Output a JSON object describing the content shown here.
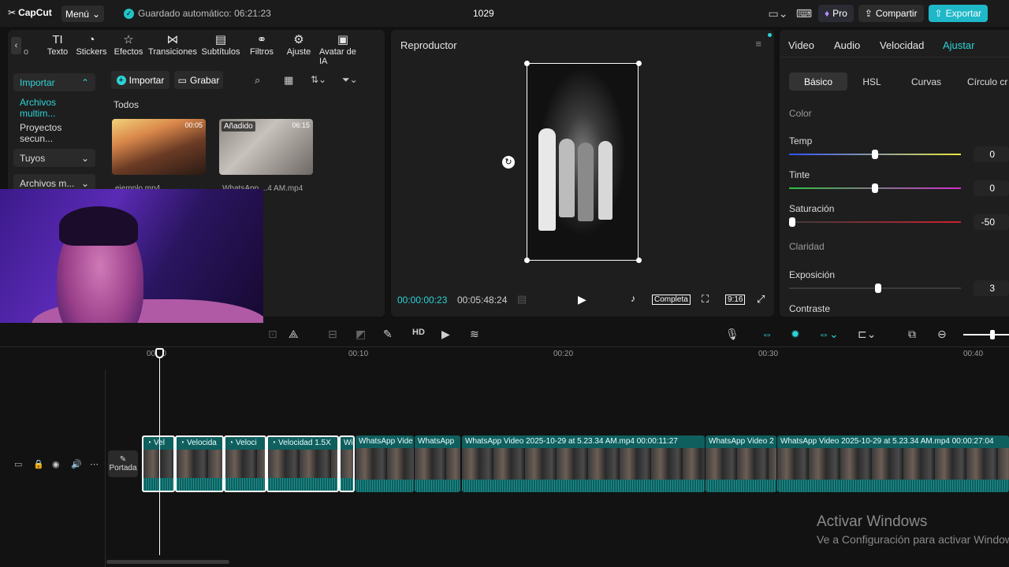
{
  "topbar": {
    "logo": "CapCut",
    "menu_label": "Menú",
    "autosave": "Guardado automático: 06:21:23",
    "project_title": "1029",
    "pro_label": "Pro",
    "share_label": "Compartir",
    "export_label": "Exportar"
  },
  "toolbar_tabs": [
    {
      "label": "Texto",
      "icon": "text-icon"
    },
    {
      "label": "Stickers",
      "icon": "sticker-icon"
    },
    {
      "label": "Efectos",
      "icon": "effects-icon"
    },
    {
      "label": "Transiciones",
      "icon": "transition-icon"
    },
    {
      "label": "Subtítulos",
      "icon": "subtitle-icon"
    },
    {
      "label": "Filtros",
      "icon": "filter-icon"
    },
    {
      "label": "Ajuste",
      "icon": "adjust-icon"
    },
    {
      "label": "Avatar de IA",
      "icon": "avatar-icon"
    }
  ],
  "sidebar": {
    "importar": "Importar",
    "archivos": "Archivos multim...",
    "proyectos": "Proyectos secun...",
    "tuyos": "Tuyos",
    "archivos2": "Archivos m..."
  },
  "media": {
    "import_btn": "Importar",
    "record_btn": "Grabar",
    "filter_all": "Todos",
    "items": [
      {
        "name": "ejemplo.mp4",
        "duration": "00:05"
      },
      {
        "name": "WhatsApp ...4 AM.mp4",
        "duration": "06:15",
        "badge": "Añadido"
      }
    ]
  },
  "player": {
    "title": "Reproductor",
    "current_time": "00:00:00:23",
    "total_time": "00:05:48:24",
    "quality": "Completa",
    "ratio": "9:16"
  },
  "adjust_panel": {
    "tabs": [
      "Video",
      "Audio",
      "Velocidad",
      "Ajustar"
    ],
    "active_tab": "Ajustar",
    "subtabs": [
      "Básico",
      "HSL",
      "Curvas",
      "Círculo cr"
    ],
    "section_color": "Color",
    "temp_label": "Temp",
    "temp_value": "0",
    "temp_level": 0.5,
    "tinte_label": "Tinte",
    "tinte_value": "0",
    "tinte_level": 0.5,
    "sat_label": "Saturación",
    "sat_value": "-50",
    "sat_level": 0.0,
    "section_claridad": "Claridad",
    "exp_label": "Exposición",
    "exp_value": "3",
    "exp_level": 0.52,
    "contraste_label": "Contraste"
  },
  "timeline": {
    "ticks": [
      "00:00",
      "00:10",
      "00:20",
      "00:30",
      "00:40"
    ],
    "cover_label": "Portada",
    "clips": [
      {
        "label": "Vel",
        "selected": true
      },
      {
        "label": "Velocida",
        "selected": true
      },
      {
        "label": "Veloci",
        "selected": true
      },
      {
        "label": "Velocidad 1.5X",
        "selected": true
      },
      {
        "label": "Wi",
        "selected": false
      },
      {
        "label": "WhatsApp Vide",
        "selected": false
      },
      {
        "label": "WhatsApp",
        "selected": false
      },
      {
        "label": "WhatsApp Video 2025-10-29 at 5.23.34 AM.mp4  00:00:11:27",
        "selected": false
      },
      {
        "label": "WhatsApp Video 2",
        "selected": false
      },
      {
        "label": "WhatsApp Video 2025-10-29 at 5.23.34 AM.mp4  00:00:27:04",
        "selected": false
      }
    ]
  },
  "watermark": {
    "line1": "Activar Windows",
    "line2": "Ve a Configuración para activar Windows."
  }
}
